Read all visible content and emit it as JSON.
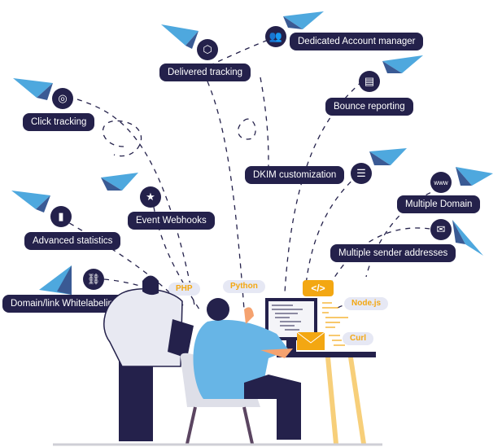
{
  "features": [
    {
      "id": "click-tracking",
      "label": "Click tracking",
      "icon": "target-cursor-icon"
    },
    {
      "id": "delivered-tracking",
      "label": "Delivered tracking",
      "icon": "package-route-icon"
    },
    {
      "id": "dedicated-account-manager",
      "label": "Dedicated Account manager",
      "icon": "team-icon"
    },
    {
      "id": "bounce-reporting",
      "label": "Bounce reporting",
      "icon": "document-icon"
    },
    {
      "id": "dkim-customization",
      "label": "DKIM customization",
      "icon": "settings-sliders-icon"
    },
    {
      "id": "multiple-domain",
      "label": "Multiple Domain",
      "icon": "www-globe-icon"
    },
    {
      "id": "multiple-sender-addresses",
      "label": "Multiple sender addresses",
      "icon": "envelope-forward-icon"
    },
    {
      "id": "event-webhooks",
      "label": "Event Webhooks",
      "icon": "calendar-star-icon"
    },
    {
      "id": "advanced-statistics",
      "label": "Advanced statistics",
      "icon": "bar-chart-icon"
    },
    {
      "id": "domain-link-whitelabeling",
      "label": "Domain/link Whitelabeling",
      "icon": "broken-link-icon"
    }
  ],
  "languages": [
    "PHP",
    "Python",
    "Node.js",
    "Curl"
  ],
  "code_symbol": "</>",
  "colors": {
    "navy": "#24214b",
    "accent": "#f3a712",
    "plane": "#4ea8de",
    "plane_dark": "#3a5a94",
    "tag_bg": "#e6e8f4"
  }
}
